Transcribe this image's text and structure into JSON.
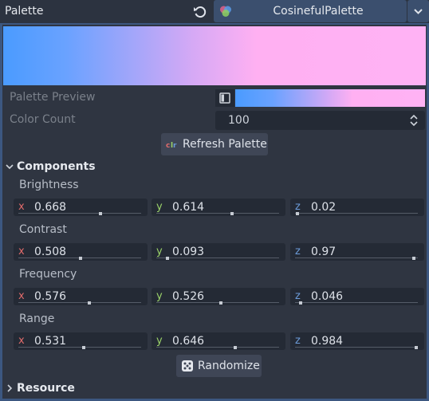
{
  "header": {
    "property_label": "Palette",
    "revert_icon": "revert-icon",
    "resource_icon": "palette-resource-icon",
    "resource_name": "CosinefulPalette",
    "dropdown_icon": "chevron-down-icon"
  },
  "palette_preview": {
    "label": "Palette Preview",
    "icon": "panel-icon",
    "colors": [
      "#4a9bff",
      "#d6a9f5",
      "#ffb2f4"
    ]
  },
  "color_count": {
    "label": "Color Count",
    "value": "100"
  },
  "refresh_button": {
    "icon": "clr-icon",
    "label": "Refresh Palette"
  },
  "components": {
    "title": "Components",
    "groups": [
      {
        "label": "Brightness",
        "x": "0.668",
        "y": "0.614",
        "z": "0.02",
        "fx": 0.668,
        "fy": 0.614,
        "fz": 0.02
      },
      {
        "label": "Contrast",
        "x": "0.508",
        "y": "0.093",
        "z": "0.97",
        "fx": 0.508,
        "fy": 0.093,
        "fz": 0.97
      },
      {
        "label": "Frequency",
        "x": "0.576",
        "y": "0.526",
        "z": "0.046",
        "fx": 0.576,
        "fy": 0.526,
        "fz": 0.046
      },
      {
        "label": "Range",
        "x": "0.531",
        "y": "0.646",
        "z": "0.984",
        "fx": 0.531,
        "fy": 0.646,
        "fz": 0.984
      }
    ],
    "axis_labels": {
      "x": "x",
      "y": "y",
      "z": "z"
    }
  },
  "randomize_button": {
    "icon": "dice-icon",
    "label": "Randomize"
  },
  "resource_section": {
    "title": "Resource"
  },
  "colors": {
    "accent": "#3b4f6e",
    "axis_x": "#e06b6b",
    "axis_y": "#9bd36a",
    "axis_z": "#6b9bd8"
  }
}
